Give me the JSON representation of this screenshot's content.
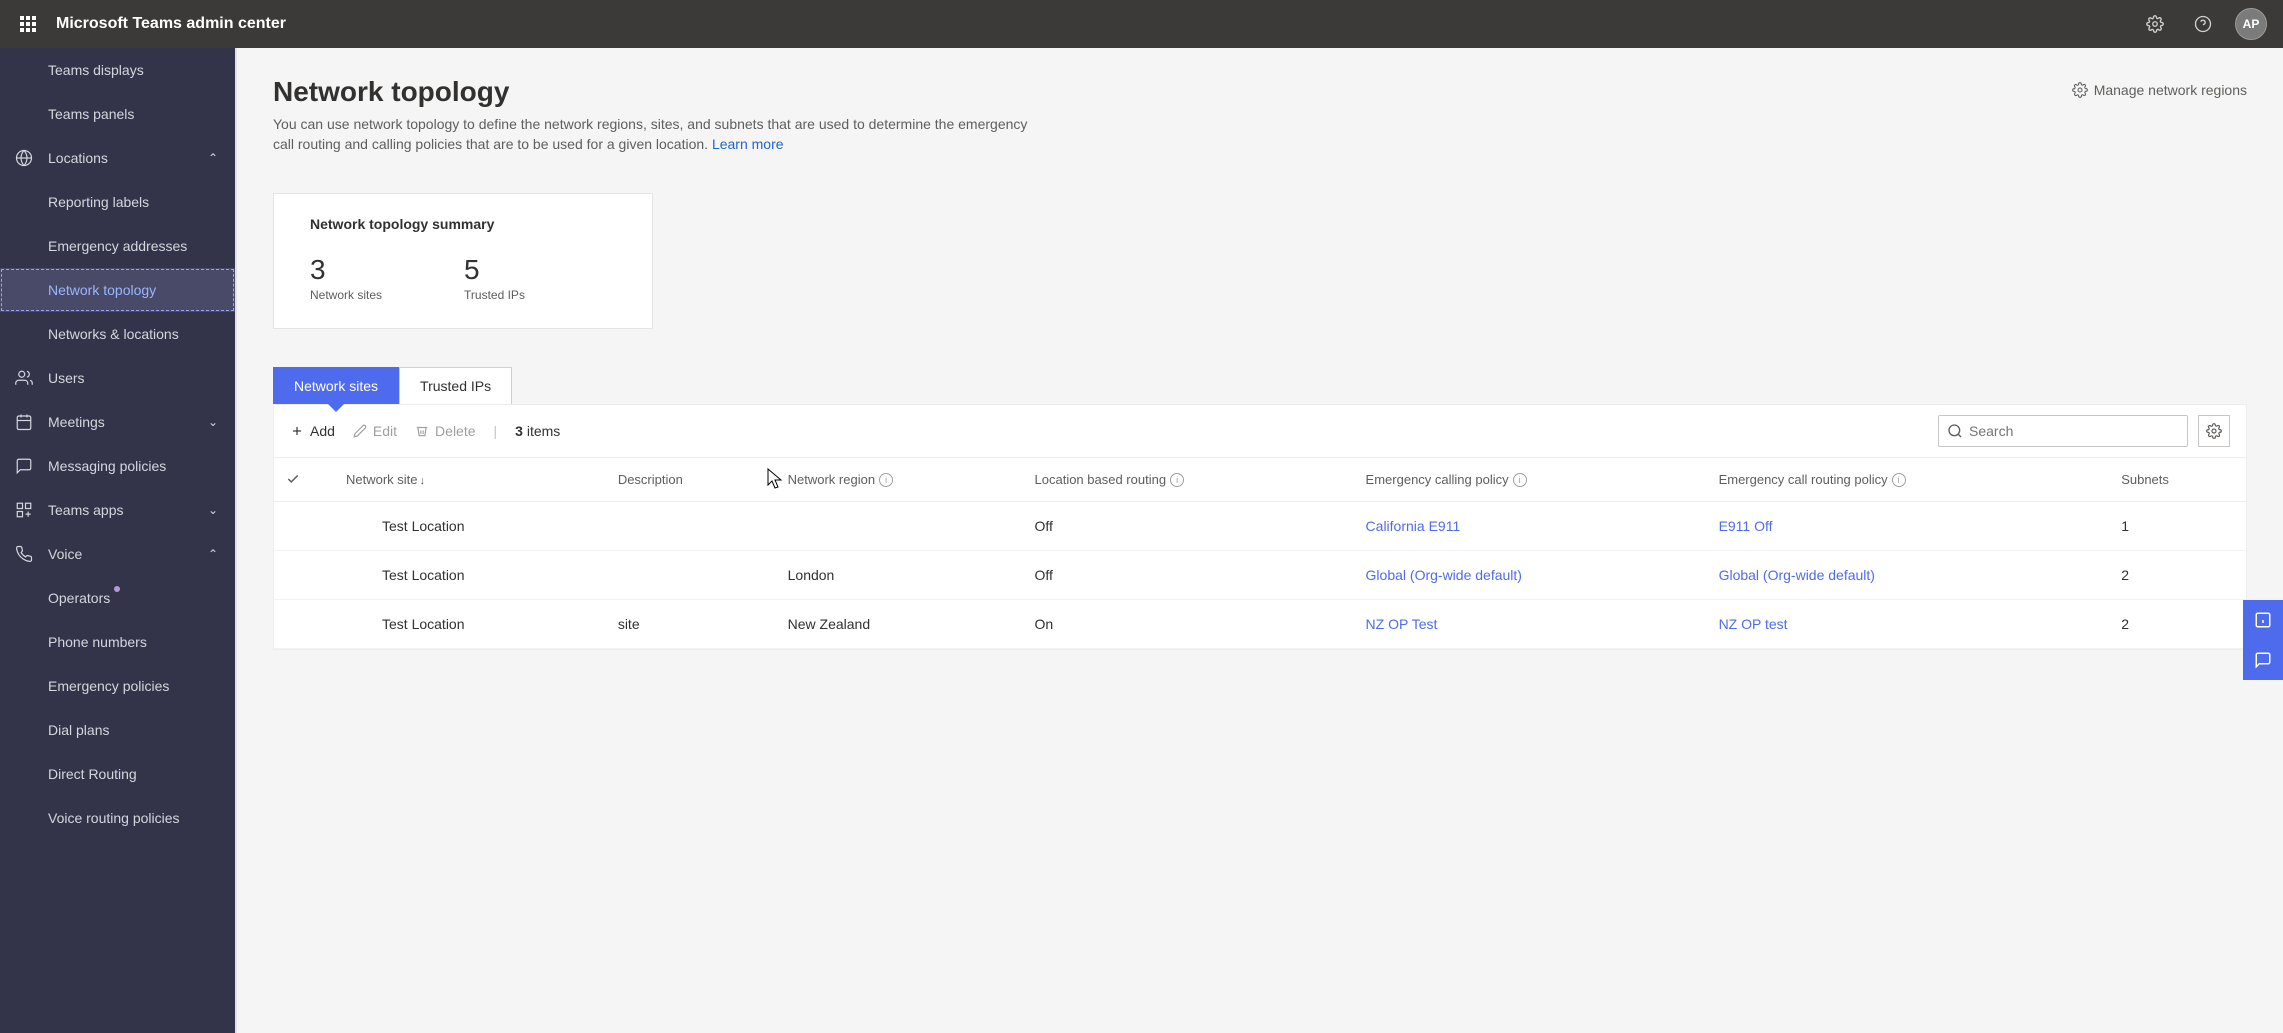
{
  "topbar": {
    "app_title": "Microsoft Teams admin center",
    "avatar_initials": "AP"
  },
  "sidebar": {
    "items": [
      {
        "label": "Teams displays",
        "indent": true
      },
      {
        "label": "Teams panels",
        "indent": true
      },
      {
        "label": "Locations",
        "icon": "globe",
        "expandable": true,
        "expanded": true
      },
      {
        "label": "Reporting labels",
        "indent": true
      },
      {
        "label": "Emergency addresses",
        "indent": true
      },
      {
        "label": "Network topology",
        "indent": true,
        "active": true
      },
      {
        "label": "Networks & locations",
        "indent": true
      },
      {
        "label": "Users",
        "icon": "users"
      },
      {
        "label": "Meetings",
        "icon": "calendar",
        "expandable": true
      },
      {
        "label": "Messaging policies",
        "icon": "chat"
      },
      {
        "label": "Teams apps",
        "icon": "apps",
        "expandable": true
      },
      {
        "label": "Voice",
        "icon": "phone",
        "expandable": true,
        "expanded": true
      },
      {
        "label": "Operators",
        "indent": true,
        "dot": true
      },
      {
        "label": "Phone numbers",
        "indent": true
      },
      {
        "label": "Emergency policies",
        "indent": true
      },
      {
        "label": "Dial plans",
        "indent": true
      },
      {
        "label": "Direct Routing",
        "indent": true
      },
      {
        "label": "Voice routing policies",
        "indent": true
      }
    ]
  },
  "page": {
    "title": "Network topology",
    "description_main": "You can use network topology to define the network regions, sites, and subnets that are used to determine the emergency call routing and calling policies that are to be used for a given location. ",
    "learn_more": "Learn more",
    "manage_regions": "Manage network regions"
  },
  "summary": {
    "title": "Network topology summary",
    "stats": [
      {
        "value": "3",
        "label": "Network sites"
      },
      {
        "value": "5",
        "label": "Trusted IPs"
      }
    ]
  },
  "tabs": [
    {
      "label": "Network sites",
      "active": true
    },
    {
      "label": "Trusted IPs",
      "active": false
    }
  ],
  "toolbar": {
    "add": "Add",
    "edit": "Edit",
    "delete": "Delete",
    "count_num": "3",
    "count_word": "items",
    "search_placeholder": "Search"
  },
  "table": {
    "columns": [
      "Network site",
      "Description",
      "Network region",
      "Location based routing",
      "Emergency calling policy",
      "Emergency call routing policy",
      "Subnets"
    ],
    "rows": [
      {
        "site": "Test Location",
        "desc": "",
        "region": "",
        "lbr": "Off",
        "ecp": "California E911",
        "ecrp": "E911 Off",
        "subnets": "1"
      },
      {
        "site": "Test Location",
        "desc": "",
        "region": "London",
        "lbr": "Off",
        "ecp": "Global (Org-wide default)",
        "ecrp": "Global (Org-wide default)",
        "subnets": "2"
      },
      {
        "site": "Test Location",
        "desc": "site",
        "region": "New Zealand",
        "lbr": "On",
        "ecp": "NZ OP Test",
        "ecrp": "NZ OP test",
        "subnets": "2"
      }
    ]
  }
}
